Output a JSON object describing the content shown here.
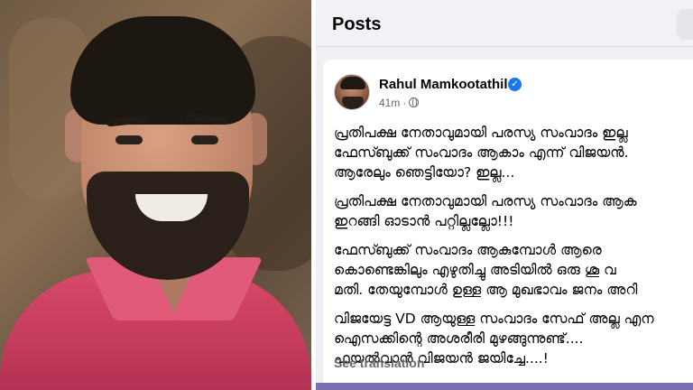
{
  "posts_header": {
    "title": "Posts"
  },
  "post": {
    "author": "Rahul Mamkootathil",
    "verified_icon": "✓",
    "time": "41m",
    "separator": "·",
    "paragraphs": [
      [
        "പ്രതിപക്ഷ നേതാവുമായി പരസ്യ സംവാദം ഇല്ല",
        "ഫേസ്ബുക്ക് സംവാദം ആകാം എന്ന് വിജയൻ.",
        "ആരേലും ഞെട്ടിയോ? ഇല്ല..."
      ],
      [
        "പ്രതിപക്ഷ നേതാവുമായി പരസ്യ സംവാദം ആക",
        "ഇറങ്ങി ഓടാൻ പറ്റില്ലല്ലോ!!!"
      ],
      [
        "ഫേസ്ബുക്ക് സംവാദം ആകുമ്പോൾ ആരെ",
        "കൊണ്ടെങ്കിലും എഴുതിച്ചു അടിയിൽ ഒരു ശൂ വ",
        "മതി. തേയുമ്പോൾ ഉള്ള ആ മുഖഭാവം ജനം അറി"
      ],
      [
        "വിജയേട്ട VD ആയുള്ള സംവാദം സേഫ് അല്ല എന",
        "ഐസക്കിന്റെ അശരീരി മുഴങ്ങുന്നുണ്ട്....",
        "ഫയൽവാൻ വിജയൻ ജയിച്ചേ....!"
      ]
    ],
    "see_translation": "See translation"
  },
  "icons": {
    "privacy": "globe-icon",
    "verified": "verified-badge-icon"
  },
  "colors": {
    "accent": "#1877f2",
    "shirt": "#d64a6b",
    "feed_bg": "#eef0f4"
  }
}
